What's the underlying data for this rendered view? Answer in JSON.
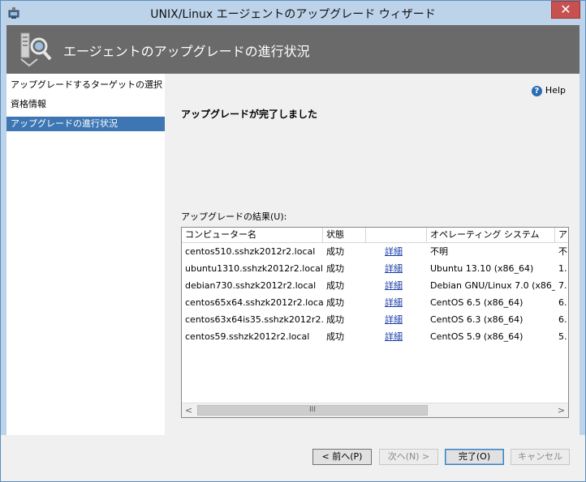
{
  "window": {
    "title": "UNIX/Linux エージェントのアップグレード ウィザード",
    "close_glyph": "✕"
  },
  "header": {
    "title": "エージェントのアップグレードの進行状況",
    "icon": "agent-upgrade-icon"
  },
  "nav": {
    "items": [
      {
        "label": "アップグレードするターゲットの選択",
        "selected": false
      },
      {
        "label": "資格情報",
        "selected": false
      },
      {
        "label": "アップグレードの進行状況",
        "selected": true
      }
    ]
  },
  "main": {
    "help_label": "Help",
    "status_text": "アップグレードが完了しました",
    "results_label": "アップグレードの結果(U):",
    "columns": [
      "コンピューター名",
      "状態",
      "",
      "オペレーティング システム",
      "ア"
    ],
    "rows": [
      {
        "computer": "centos510.sshzk2012r2.local",
        "status": "成功",
        "detail": "詳細",
        "os": "不明",
        "extra": "不"
      },
      {
        "computer": "ubuntu1310.sshzk2012r2.local",
        "status": "成功",
        "detail": "詳細",
        "os": "Ubuntu 13.10 (x86_64)",
        "extra": "1."
      },
      {
        "computer": "debian730.sshzk2012r2.local",
        "status": "成功",
        "detail": "詳細",
        "os": "Debian GNU/Linux 7.0 (x86_64)",
        "extra": "7."
      },
      {
        "computer": "centos65x64.sshzk2012r2.local",
        "status": "成功",
        "detail": "詳細",
        "os": "CentOS 6.5 (x86_64)",
        "extra": "6."
      },
      {
        "computer": "centos63x64is35.sshzk2012r2.local",
        "status": "成功",
        "detail": "詳細",
        "os": "CentOS 6.3 (x86_64)",
        "extra": "6."
      },
      {
        "computer": "centos59.sshzk2012r2.local",
        "status": "成功",
        "detail": "詳細",
        "os": "CentOS 5.9 (x86_64)",
        "extra": "5."
      }
    ],
    "scroll_left": "<",
    "scroll_right": ">",
    "scroll_thumb": "III"
  },
  "buttons": {
    "back": "< 前へ(P)",
    "next": "次へ(N) >",
    "finish": "完了(O)",
    "cancel": "キャンセル"
  },
  "colors": {
    "accent": "#3d76b3",
    "header_bg": "#6a6a6a",
    "title_bg": "#bcd3ea",
    "link": "#1a3ea8"
  }
}
